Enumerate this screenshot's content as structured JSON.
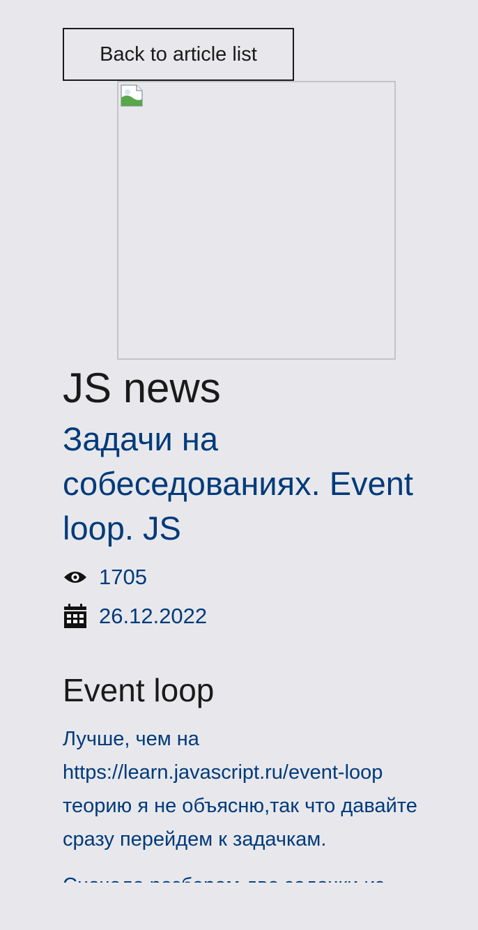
{
  "back_button": {
    "label": "Back to article list"
  },
  "article": {
    "section": "JS news",
    "title": "Задачи на собеседованиях. Event loop. JS",
    "views": "1705",
    "date": "26.12.2022",
    "icons": {
      "views": "eye-icon",
      "date": "calendar-icon",
      "image": "broken-image-icon"
    }
  },
  "content": {
    "heading": "Event loop",
    "paragraph1": "Лучше, чем на https://learn.javascript.ru/event-loop теорию я не объясню,так что давайте сразу перейдем к задачкам.",
    "paragraph2": "Сначала разберем две задачки из"
  },
  "colors": {
    "background": "#e8e8ec",
    "link_blue": "#003a7a",
    "text": "#1a1a1a"
  }
}
